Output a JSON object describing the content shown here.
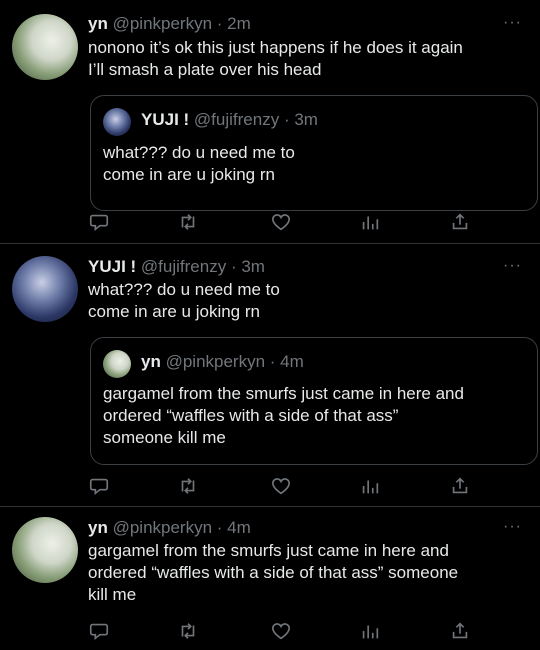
{
  "tweets": [
    {
      "name": "yn",
      "handle": "@pinkperkyn",
      "time": "· 2m",
      "more": "···",
      "lines": [
        "nonono it’s ok this just happens if he does it again",
        "I’ll smash a plate over his head"
      ],
      "quote": {
        "name": "YUJI !",
        "handle": "@fujifrenzy",
        "time": "· 3m",
        "lines": [
          "what??? do u need me to",
          "come in are u joking rn"
        ]
      }
    },
    {
      "name": "YUJI !",
      "handle": "@fujifrenzy",
      "time": "· 3m",
      "more": "···",
      "lines": [
        "what??? do u need me to",
        "come in are u joking rn"
      ],
      "quote": {
        "name": "yn",
        "handle": "@pinkperkyn",
        "time": "· 4m",
        "lines": [
          "gargamel from the smurfs just came in here and",
          "ordered “waffles with a side of that ass”",
          "someone kill me"
        ]
      }
    },
    {
      "name": "yn",
      "handle": "@pinkperkyn",
      "time": "· 4m",
      "more": "···",
      "lines": [
        "gargamel from the smurfs just came in here and",
        "ordered “waffles with a side of that ass” someone",
        "kill me"
      ]
    }
  ],
  "icons": {
    "reply": "reply-icon",
    "retweet": "retweet-icon",
    "like": "heart-icon",
    "analytics": "analytics-icon",
    "share": "share-icon"
  },
  "colors": {
    "background": "#000000",
    "text": "#e7e9ea",
    "secondary": "#71767b",
    "border": "#2f3336"
  }
}
